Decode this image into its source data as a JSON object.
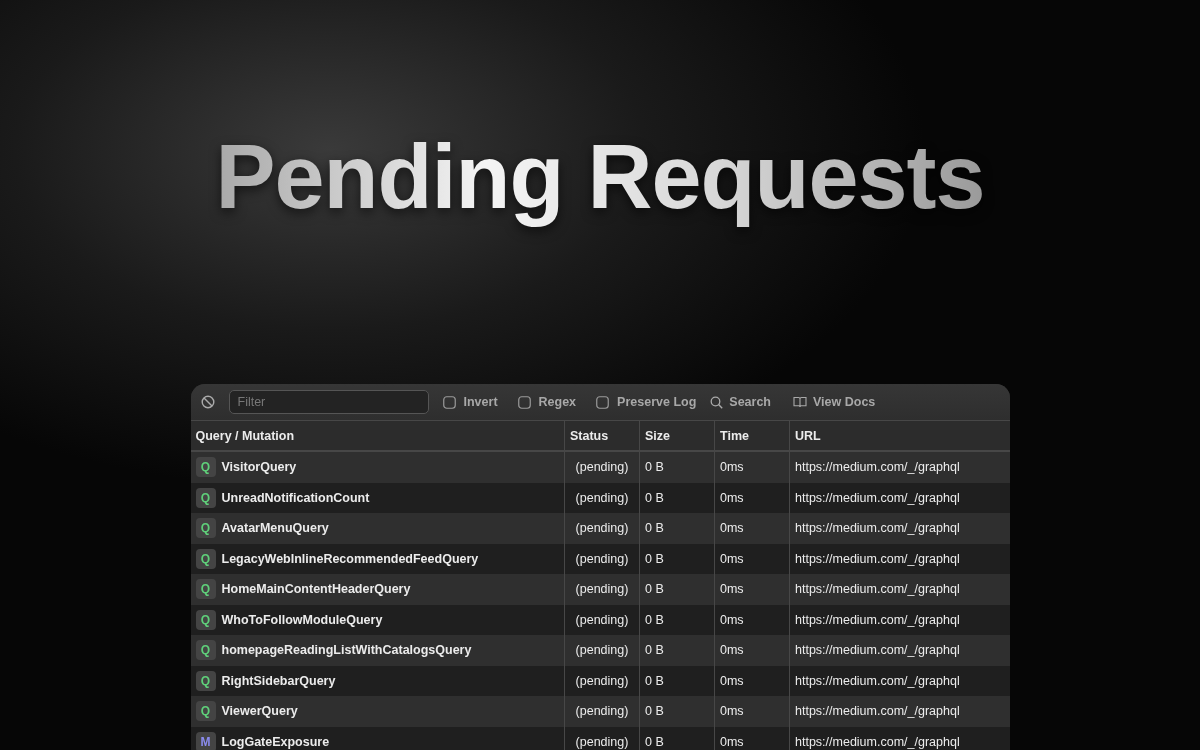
{
  "headline": "Pending Requests",
  "toolbar": {
    "filter": {
      "placeholder": "Filter"
    },
    "options": [
      {
        "label": "Invert",
        "checked": false
      },
      {
        "label": "Regex",
        "checked": false
      },
      {
        "label": "Preserve Log",
        "checked": false
      }
    ],
    "search": "Search",
    "docs": "View Docs"
  },
  "table": {
    "columns": [
      "Query / Mutation",
      "Status",
      "Size",
      "Time",
      "URL"
    ],
    "rows": [
      {
        "kind": "query",
        "badge": "Q",
        "name": "VisitorQuery",
        "status": "(pending)",
        "size": "0 B",
        "time": "0ms",
        "url": "https://medium.com/_/graphql"
      },
      {
        "kind": "query",
        "badge": "Q",
        "name": "UnreadNotificationCount",
        "status": "(pending)",
        "size": "0 B",
        "time": "0ms",
        "url": "https://medium.com/_/graphql"
      },
      {
        "kind": "query",
        "badge": "Q",
        "name": "AvatarMenuQuery",
        "status": "(pending)",
        "size": "0 B",
        "time": "0ms",
        "url": "https://medium.com/_/graphql"
      },
      {
        "kind": "query",
        "badge": "Q",
        "name": "LegacyWebInlineRecommendedFeedQuery",
        "status": "(pending)",
        "size": "0 B",
        "time": "0ms",
        "url": "https://medium.com/_/graphql"
      },
      {
        "kind": "query",
        "badge": "Q",
        "name": "HomeMainContentHeaderQuery",
        "status": "(pending)",
        "size": "0 B",
        "time": "0ms",
        "url": "https://medium.com/_/graphql"
      },
      {
        "kind": "query",
        "badge": "Q",
        "name": "WhoToFollowModuleQuery",
        "status": "(pending)",
        "size": "0 B",
        "time": "0ms",
        "url": "https://medium.com/_/graphql"
      },
      {
        "kind": "query",
        "badge": "Q",
        "name": "homepageReadingListWithCatalogsQuery",
        "status": "(pending)",
        "size": "0 B",
        "time": "0ms",
        "url": "https://medium.com/_/graphql"
      },
      {
        "kind": "query",
        "badge": "Q",
        "name": "RightSidebarQuery",
        "status": "(pending)",
        "size": "0 B",
        "time": "0ms",
        "url": "https://medium.com/_/graphql"
      },
      {
        "kind": "query",
        "badge": "Q",
        "name": "ViewerQuery",
        "status": "(pending)",
        "size": "0 B",
        "time": "0ms",
        "url": "https://medium.com/_/graphql"
      },
      {
        "kind": "mutation",
        "badge": "M",
        "name": "LogGateExposure",
        "status": "(pending)",
        "size": "0 B",
        "time": "0ms",
        "url": "https://medium.com/_/graphql"
      }
    ]
  }
}
